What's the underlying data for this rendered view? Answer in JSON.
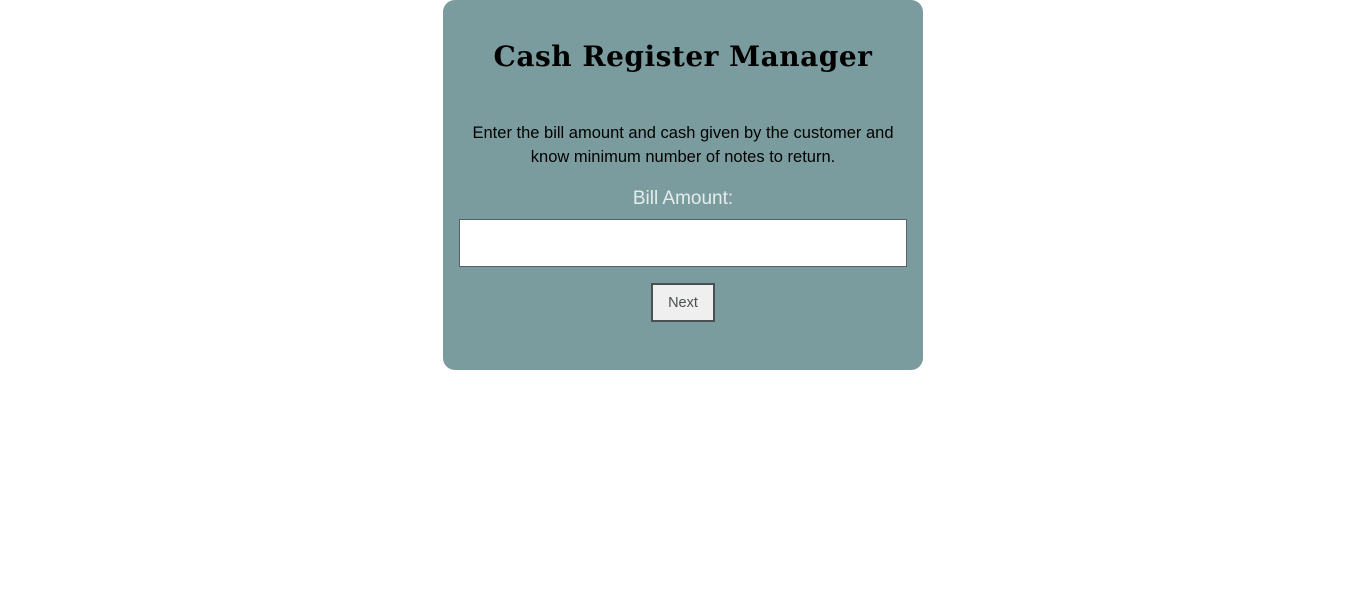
{
  "app": {
    "title": "Cash Register Manager",
    "description": "Enter the bill amount and cash given by the customer and know minimum number of notes to return."
  },
  "form": {
    "bill_amount_label": "Bill Amount:",
    "bill_amount_value": "",
    "next_label": "Next"
  },
  "colors": {
    "card_background": "#7b9c9e",
    "label_text": "#e5ecec",
    "page_background": "#ffffff"
  }
}
